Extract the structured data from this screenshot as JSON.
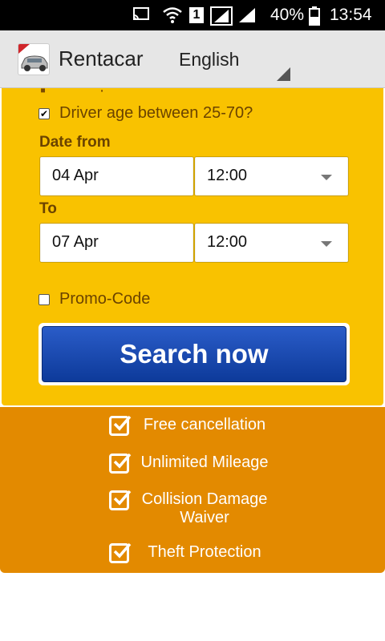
{
  "status_bar": {
    "battery_percent": "40%",
    "time": "13:54",
    "sim_badge": "1"
  },
  "app_bar": {
    "title": "Rentacar",
    "language": "English"
  },
  "form": {
    "driver_age_label": "Driver age between 25-70?",
    "driver_age_checked": true,
    "date_from_label": "Date from",
    "date_from_value": "04 Apr",
    "time_from_value": "12:00",
    "to_label": "To",
    "date_to_value": "07 Apr",
    "time_to_value": "12:00",
    "promo_label": "Promo-Code",
    "promo_checked": false,
    "search_button": "Search now"
  },
  "benefits": [
    "Free cancellation",
    "Unlimited Mileage",
    "Collision Damage Waiver",
    "Theft Protection"
  ],
  "colors": {
    "form_bg": "#f9c200",
    "benefits_bg": "#e38a00",
    "button_blue": "#1a49b0"
  }
}
